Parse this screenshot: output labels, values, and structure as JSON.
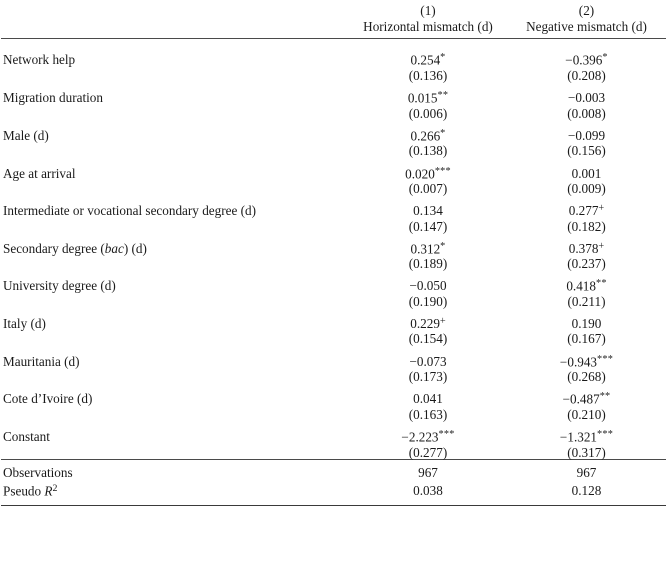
{
  "table": {
    "columns": [
      {
        "number": "",
        "name": ""
      },
      {
        "number": "(1)",
        "name": "Horizontal mismatch (d)"
      },
      {
        "number": "(2)",
        "name": "Negative mismatch (d)"
      }
    ],
    "rows": [
      {
        "label": "Network help",
        "label_italic_part": "",
        "coef": [
          "0.254",
          "−0.396"
        ],
        "stars": [
          "*",
          "*"
        ],
        "se": [
          "(0.136)",
          "(0.208)"
        ]
      },
      {
        "label": "Migration duration",
        "coef": [
          "0.015",
          "−0.003"
        ],
        "stars": [
          "**",
          ""
        ],
        "se": [
          "(0.006)",
          "(0.008)"
        ]
      },
      {
        "label": "Male (d)",
        "coef": [
          "0.266",
          "−0.099"
        ],
        "stars": [
          "*",
          ""
        ],
        "se": [
          "(0.138)",
          "(0.156)"
        ]
      },
      {
        "label": "Age at arrival",
        "coef": [
          "0.020",
          "0.001"
        ],
        "stars": [
          "***",
          ""
        ],
        "se": [
          "(0.007)",
          "(0.009)"
        ]
      },
      {
        "label": "Intermediate or vocational secondary degree (d)",
        "coef": [
          "0.134",
          "0.277"
        ],
        "stars": [
          "",
          "+"
        ],
        "se": [
          "(0.147)",
          "(0.182)"
        ]
      },
      {
        "label_pre": "Secondary degree (",
        "label_italic": "bac",
        "label_post": ") (d)",
        "label": "Secondary degree (bac) (d)",
        "coef": [
          "0.312",
          "0.378"
        ],
        "stars": [
          "*",
          "+"
        ],
        "se": [
          "(0.189)",
          "(0.237)"
        ]
      },
      {
        "label": "University degree (d)",
        "coef": [
          "−0.050",
          "0.418"
        ],
        "stars": [
          "",
          "**"
        ],
        "se": [
          "(0.190)",
          "(0.211)"
        ]
      },
      {
        "label": "Italy (d)",
        "coef": [
          "0.229",
          "0.190"
        ],
        "stars": [
          "+",
          ""
        ],
        "se": [
          "(0.154)",
          "(0.167)"
        ]
      },
      {
        "label": "Mauritania (d)",
        "coef": [
          "−0.073",
          "−0.943"
        ],
        "stars": [
          "",
          "***"
        ],
        "se": [
          "(0.173)",
          "(0.268)"
        ]
      },
      {
        "label": "Cote d’Ivoire (d)",
        "coef": [
          "0.041",
          "−0.487"
        ],
        "stars": [
          "",
          "**"
        ],
        "se": [
          "(0.163)",
          "(0.210)"
        ]
      },
      {
        "label": "Constant",
        "coef": [
          "−2.223",
          "−1.321"
        ],
        "stars": [
          "***",
          "***"
        ],
        "se": [
          "(0.277)",
          "(0.317)"
        ]
      }
    ],
    "stats": [
      {
        "label": "Observations",
        "label_pre": "Observations",
        "label_sup": "",
        "values": [
          "967",
          "967"
        ]
      },
      {
        "label": "Pseudo R2",
        "label_pre": "Pseudo ",
        "label_italic": "R",
        "label_sup": "2",
        "values": [
          "0.038",
          "0.128"
        ]
      }
    ]
  },
  "style": {
    "rule_color": "#4a4a4a",
    "text_color": "#1a1a1a",
    "background": "#ffffff"
  }
}
